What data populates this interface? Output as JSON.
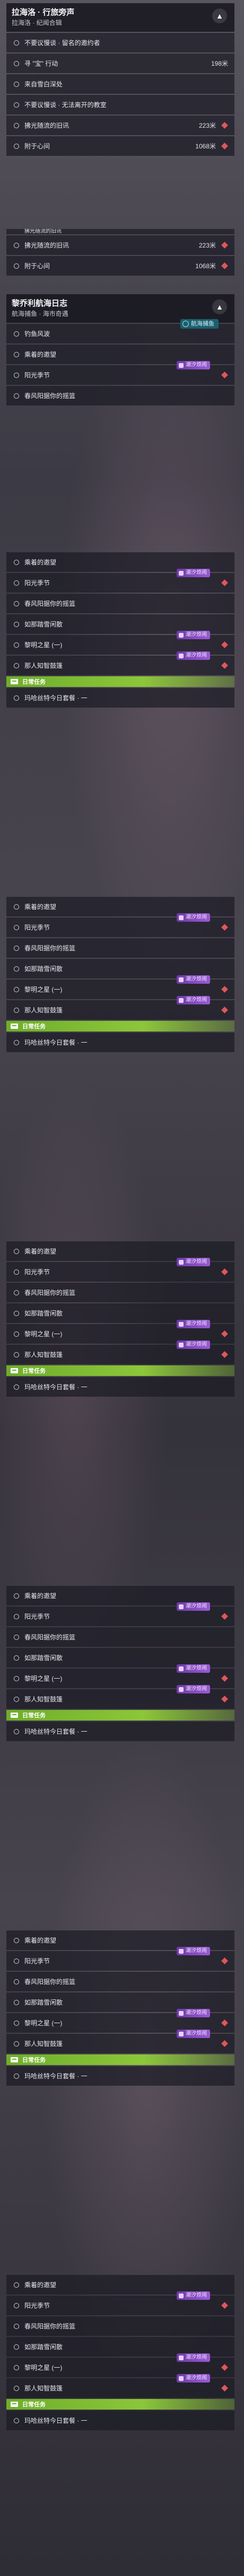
{
  "quests": [
    {
      "title": "拉海洛 · 行旅旁声",
      "subtitle": "拉海洛 · 纪闻合辑",
      "collapsed_icon": "chevron-up-icon",
      "items": [
        {
          "text": "不要议慢谈 · 留名的邀约者",
          "distance": "",
          "pin": false
        },
        {
          "text": "寻 \"宝\" 行动",
          "distance": "198米",
          "pin": false
        },
        {
          "text": "来自雪白深处",
          "distance": "",
          "pin": false
        },
        {
          "text": "不要议慢谈 · 无法离开的教室",
          "distance": "",
          "pin": false
        },
        {
          "text": "拂光随流的旧讯",
          "distance": "223米",
          "pin": true
        },
        {
          "text": "附于心间",
          "distance": "1068米",
          "pin": true
        }
      ]
    }
  ],
  "fragment": {
    "partial_text": "拂光随流的旧讯",
    "items": [
      {
        "text": "拂光随流的旧讯",
        "distance": "223米"
      },
      {
        "text": "附于心间",
        "distance": "1068米"
      }
    ]
  },
  "journal": {
    "title": "黎乔利航海日志",
    "subtitle": "航海捕鱼 · 海市奇遇",
    "teal_badge": "航海捕鱼",
    "first_item": "钓鱼风波"
  },
  "repeat_items": [
    "乘着的邀望",
    "阳光季节",
    "春风阳据你的摇篮",
    "如那踏雪闲散",
    "黎明之星 (一)",
    "那人知智鼓篷"
  ],
  "purple_badge": "潮汐烦闹",
  "daily_label": "日常任务",
  "daily_item": "玛哈丝特今日套餐 · 一"
}
